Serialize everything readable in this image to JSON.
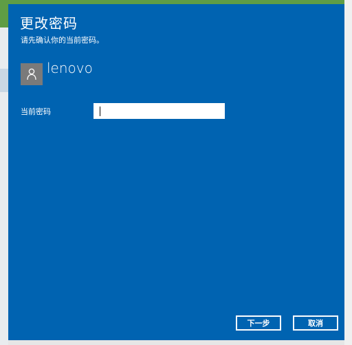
{
  "dialog": {
    "title": "更改密码",
    "subtitle": "请先确认你的当前密码。"
  },
  "account": {
    "username": "lenovo",
    "avatar_icon": "user-icon"
  },
  "form": {
    "current_password_label": "当前密码",
    "current_password_value": ""
  },
  "buttons": {
    "next_label": "下一步",
    "cancel_label": "取消"
  },
  "colors": {
    "dialog_background": "#0063b1",
    "avatar_background": "#7a7a7a",
    "text": "#ffffff"
  }
}
